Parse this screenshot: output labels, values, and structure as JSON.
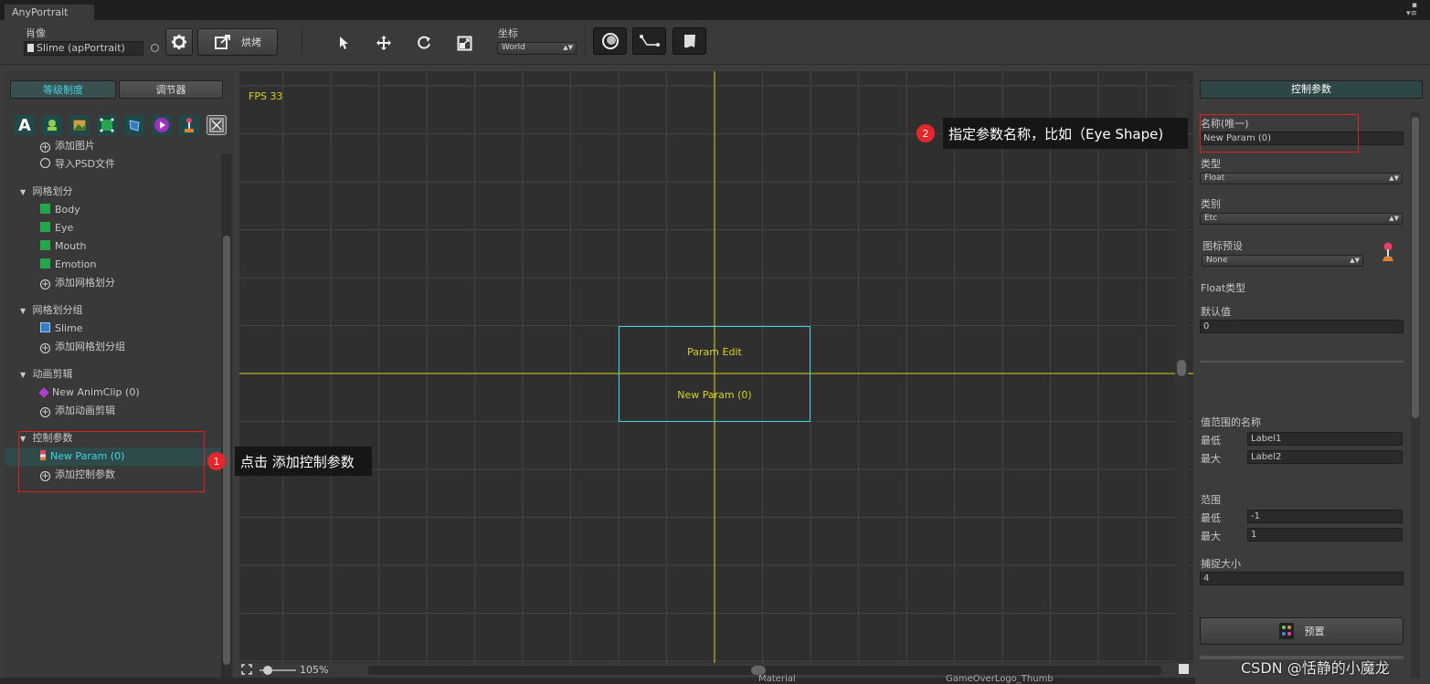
{
  "window": {
    "tab_title": "AnyPortrait",
    "controls": "▪\n▾≡"
  },
  "toolbar": {
    "portrait_label": "肖像",
    "portrait_value": "Slime (apPortrait)",
    "bake_label": "烘烤",
    "coord_label": "坐标",
    "coord_value": "World"
  },
  "left_panel": {
    "tabs": [
      {
        "label": "等级制度"
      },
      {
        "label": "调节器"
      }
    ],
    "add_image": "添加图片",
    "import_psd": "导入PSD文件",
    "mesh_section": "网格划分",
    "meshes": [
      "Body",
      "Eye",
      "Mouth",
      "Emotion"
    ],
    "add_mesh": "添加网格划分",
    "mesh_group_section": "网格划分组",
    "mesh_groups": [
      "Slime"
    ],
    "add_mesh_group": "添加网格划分组",
    "anim_section": "动画剪辑",
    "anim_clips": [
      "New AnimClip (0)"
    ],
    "add_anim": "添加动画剪辑",
    "param_section": "控制参数",
    "params": [
      "New Param (0)"
    ],
    "add_param": "添加控制参数"
  },
  "canvas": {
    "fps": "FPS 33",
    "box_title": "Param Edit",
    "box_param": "New Param (0)",
    "zoom": "105%"
  },
  "right_panel": {
    "header": "控制参数",
    "name_label": "名称(唯一)",
    "name_value": "New Param (0)",
    "type_label": "类型",
    "type_value": "Float",
    "category_label": "类别",
    "category_value": "Etc",
    "icon_preset_label": "图标预设",
    "icon_preset_value": "None",
    "float_type_label": "Float类型",
    "default_label": "默认值",
    "default_value": "0",
    "range_names_label": "值范围的名称",
    "min_label": "最低",
    "max_label": "最大",
    "label1": "Label1",
    "label2": "Label2",
    "range_label": "范围",
    "range_min": "-1",
    "range_max": "1",
    "snap_label": "捕捉大小",
    "snap_value": "4",
    "preset_button": "预置"
  },
  "annotations": {
    "callout1_num": "1",
    "callout1_text": "点击 添加控制参数",
    "callout2_num": "2",
    "callout2_text": "指定参数名称，比如（Eye Shape)"
  },
  "background_text": {
    "material": "Material",
    "thumb": "GameOverLogo_Thumb"
  },
  "watermark": "CSDN @恬静的小魔龙",
  "colors": {
    "accent": "#3fd6e0",
    "canvas_axis": "#d6d61a",
    "highlight": "#e02020"
  }
}
